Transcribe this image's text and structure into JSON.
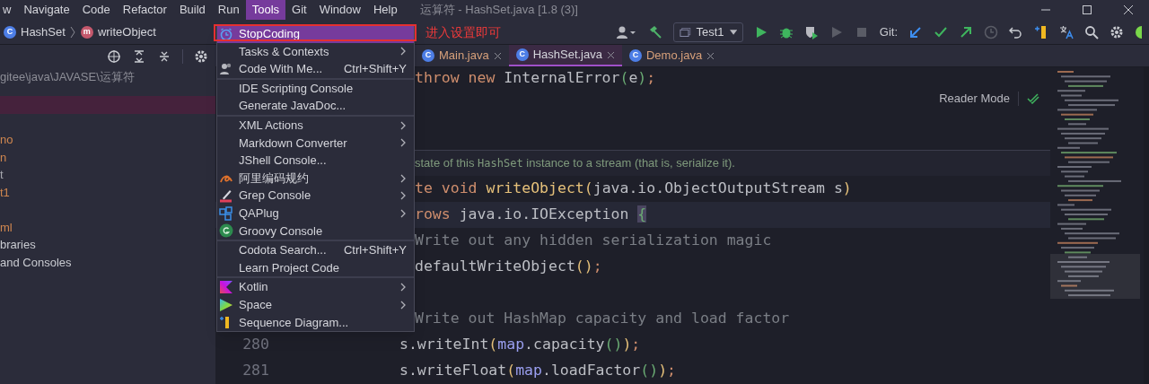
{
  "menubar": {
    "items": [
      {
        "label": "w",
        "selected": false
      },
      {
        "label": "Navigate",
        "selected": false
      },
      {
        "label": "Code",
        "selected": false
      },
      {
        "label": "Refactor",
        "selected": false
      },
      {
        "label": "Build",
        "selected": false
      },
      {
        "label": "Run",
        "selected": false
      },
      {
        "label": "Tools",
        "selected": true
      },
      {
        "label": "Git",
        "selected": false
      },
      {
        "label": "Window",
        "selected": false
      },
      {
        "label": "Help",
        "selected": false
      }
    ],
    "title": "运算符 - HashSet.java [1.8 (3)]"
  },
  "breadcrumbs": [
    {
      "badge": "C",
      "label": "HashSet",
      "kind": "class"
    },
    {
      "badge": "m",
      "label": "writeObject",
      "kind": "method"
    }
  ],
  "toolbar": {
    "run_config": "Test1",
    "git_label": "Git:"
  },
  "project": {
    "path": "gitee\\java\\JAVASE\\运算符",
    "rows": [
      {
        "selected": true
      },
      {
        "selected": false
      },
      {
        "label": "no",
        "color": "#d0874f",
        "selected": false
      },
      {
        "label": "n",
        "color": "#d0874f",
        "selected": false
      },
      {
        "label": "t",
        "color": "#a8a9b0",
        "selected": false
      },
      {
        "label": "t1",
        "color": "#d0874f",
        "selected": false
      },
      {
        "selected": false
      },
      {
        "label": "ml",
        "color": "#d0874f",
        "selected": false
      },
      {
        "label": "braries",
        "color": "#c9cbd1",
        "selected": false
      },
      {
        "label": "and Consoles",
        "color": "#c9cbd1",
        "selected": false
      }
    ]
  },
  "tabs": [
    {
      "badge": "C",
      "label": "Main.java",
      "selected": false
    },
    {
      "badge": "C",
      "label": "HashSet.java",
      "selected": true
    },
    {
      "badge": "C",
      "label": "Demo.java",
      "selected": false
    }
  ],
  "editor": {
    "reader_mode": "Reader Mode",
    "doc": {
      "before": "state of this ",
      "code": "HashSet",
      "after": " instance to a stream (that is, serialize it)."
    },
    "top_line": [
      {
        "text": "throw new ",
        "kind": "keyword"
      },
      {
        "text": "InternalError",
        "kind": "plain"
      },
      {
        "text": "(",
        "kind": "paren2"
      },
      {
        "text": "e",
        "kind": "plain"
      },
      {
        "text": ")",
        "kind": "paren2"
      },
      {
        "text": ";",
        "kind": "keyword"
      }
    ],
    "lines": [
      {
        "kind": "clipped",
        "current": false,
        "tokens": [
          {
            "text": "te void ",
            "kind": "keyword"
          },
          {
            "text": "writeObject",
            "kind": "method"
          },
          {
            "text": "(",
            "kind": "paren"
          },
          {
            "text": "java.io.ObjectOutputStream s",
            "kind": "plain"
          },
          {
            "text": ")",
            "kind": "paren"
          }
        ]
      },
      {
        "kind": "clipped",
        "current": true,
        "tokens": [
          {
            "text": "rows ",
            "kind": "keyword"
          },
          {
            "text": "java.io.IOException ",
            "kind": "plain"
          },
          {
            "text": "{",
            "kind": "brace"
          }
        ]
      },
      {
        "kind": "clipped",
        "current": false,
        "tokens": [
          {
            "text": "Write out any hidden serialization magic",
            "kind": "comment"
          }
        ]
      },
      {
        "kind": "clipped",
        "current": false,
        "tokens": [
          {
            "text": "defaultWriteObject",
            "kind": "plain"
          },
          {
            "text": "()",
            "kind": "paren"
          },
          {
            "text": ";",
            "kind": "keyword"
          }
        ]
      },
      {
        "kind": "blank",
        "current": false
      },
      {
        "kind": "clipped",
        "current": false,
        "tokens": [
          {
            "text": "Write out HashMap capacity and load factor",
            "kind": "comment"
          }
        ]
      },
      {
        "kind": "code",
        "number": "280",
        "current": false,
        "tokens": [
          {
            "text": "s.writeInt",
            "kind": "plain"
          },
          {
            "text": "(",
            "kind": "paren"
          },
          {
            "text": "map",
            "kind": "field"
          },
          {
            "text": ".capacity",
            "kind": "plain"
          },
          {
            "text": "()",
            "kind": "paren2"
          },
          {
            "text": ")",
            "kind": "paren"
          },
          {
            "text": ";",
            "kind": "keyword"
          }
        ]
      },
      {
        "kind": "code",
        "number": "281",
        "current": false,
        "tokens": [
          {
            "text": "s.writeFloat",
            "kind": "plain"
          },
          {
            "text": "(",
            "kind": "paren"
          },
          {
            "text": "map",
            "kind": "field"
          },
          {
            "text": ".loadFactor",
            "kind": "plain"
          },
          {
            "text": "()",
            "kind": "paren2"
          },
          {
            "text": ")",
            "kind": "paren"
          },
          {
            "text": ";",
            "kind": "keyword"
          }
        ]
      }
    ]
  },
  "tools_menu": {
    "annotation": "进入设置即可",
    "groups": [
      [
        {
          "label": "StopCoding",
          "kind": "clock",
          "selected": true,
          "submenu": false
        },
        {
          "label": "Tasks & Contexts",
          "submenu": true,
          "selected": false
        },
        {
          "label": "Code With Me...",
          "kind": "people",
          "shortcut": "Ctrl+Shift+Y",
          "submenu": false,
          "selected": false
        }
      ],
      [
        {
          "label": "IDE Scripting Console",
          "submenu": false,
          "selected": false
        },
        {
          "label": "Generate JavaDoc...",
          "submenu": false,
          "selected": false
        }
      ],
      [
        {
          "label": "XML Actions",
          "submenu": true,
          "selected": false
        },
        {
          "label": "Markdown Converter",
          "submenu": true,
          "selected": false
        },
        {
          "label": "JShell Console...",
          "submenu": false,
          "selected": false
        },
        {
          "label": "阿里编码规约",
          "kind": "swoosh",
          "submenu": true,
          "selected": false
        },
        {
          "label": "Grep Console",
          "kind": "pen",
          "submenu": true,
          "selected": false
        },
        {
          "label": "QAPlug",
          "kind": "blocks",
          "submenu": true,
          "selected": false
        },
        {
          "label": "Groovy Console",
          "kind": "groovy",
          "submenu": false,
          "selected": false
        }
      ],
      [
        {
          "label": "Codota Search...",
          "shortcut": "Ctrl+Shift+Y",
          "submenu": false,
          "selected": false
        },
        {
          "label": "Learn Project Code",
          "submenu": false,
          "selected": false
        }
      ],
      [
        {
          "label": "Kotlin",
          "kind": "kotlin",
          "submenu": true,
          "selected": false
        },
        {
          "label": "Space",
          "kind": "space",
          "submenu": true,
          "selected": false
        },
        {
          "label": "Sequence Diagram...",
          "kind": "sequence",
          "submenu": false,
          "selected": false
        }
      ]
    ]
  }
}
